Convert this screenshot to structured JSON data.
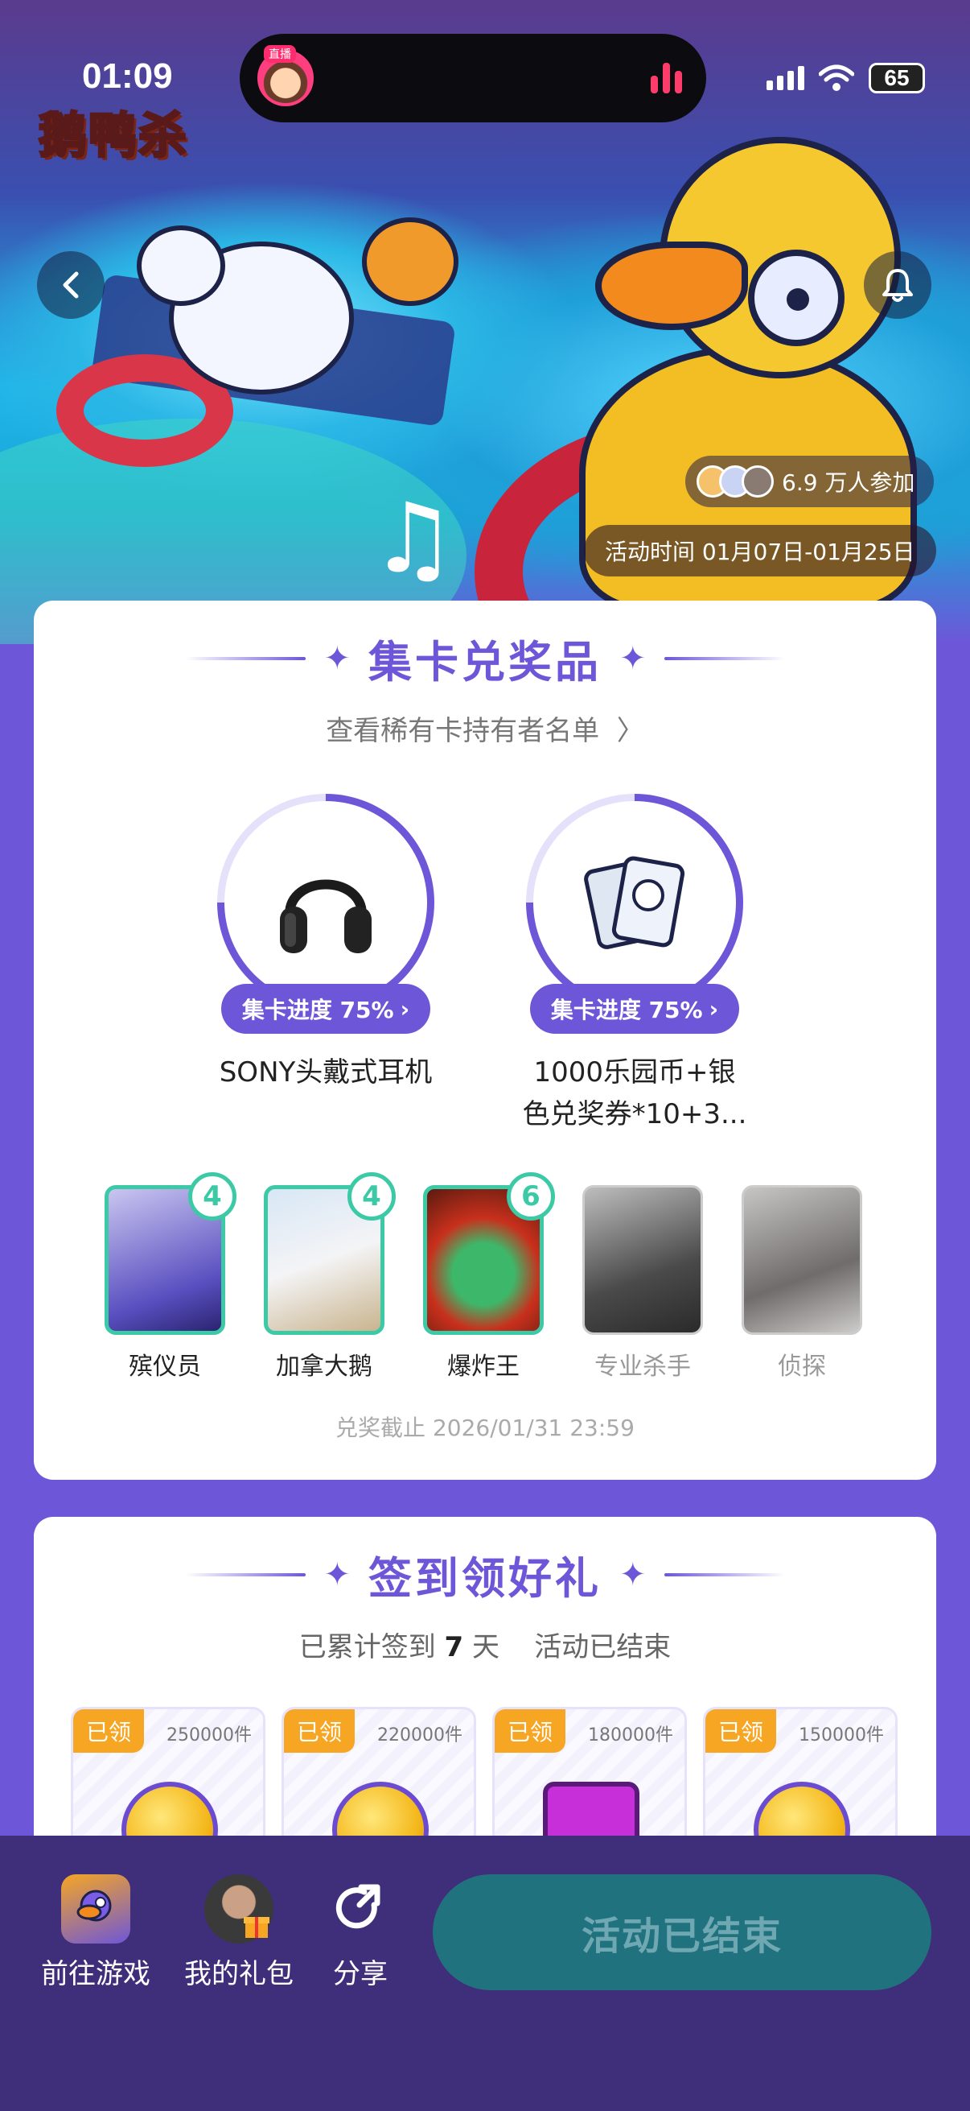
{
  "status_bar": {
    "time": "01:09",
    "live_tag": "直播",
    "battery": "65"
  },
  "hero": {
    "logo_text": "鹅鸭杀",
    "participants": "6.9 万人参加",
    "activity_time": "活动时间 01月07日-01月25日"
  },
  "card_exchange": {
    "title": "集卡兑奖品",
    "holder_link": "查看稀有卡持有者名单",
    "prizes": [
      {
        "progress_label": "集卡进度 75%",
        "progress": 0.75,
        "name": "SONY头戴式耳机"
      },
      {
        "progress_label": "集卡进度 75%",
        "progress": 0.75,
        "name_line1": "1000乐园币+银",
        "name_line2": "色兑奖券*10+3..."
      }
    ],
    "cards": [
      {
        "label": "殡仪员",
        "count": "4",
        "locked": false
      },
      {
        "label": "加拿大鹅",
        "count": "4",
        "locked": false
      },
      {
        "label": "爆炸王",
        "count": "6",
        "locked": false
      },
      {
        "label": "专业杀手",
        "locked": true
      },
      {
        "label": "侦探",
        "locked": true
      }
    ],
    "deadline": "兑奖截止 2026/01/31 23:59"
  },
  "sign_in": {
    "title": "签到领好礼",
    "summary_prefix": "已累计签到",
    "days": "7",
    "summary_suffix": "天",
    "status": "活动已结束",
    "gifts": [
      {
        "tag": "已领",
        "qty": "250000件",
        "kind": "coin"
      },
      {
        "tag": "已领",
        "qty": "220000件",
        "kind": "coin"
      },
      {
        "tag": "已领",
        "qty": "180000件",
        "kind": "box"
      },
      {
        "tag": "已领",
        "qty": "150000件",
        "kind": "coin"
      }
    ]
  },
  "bottom_bar": {
    "go_game": "前往游戏",
    "my_gifts": "我的礼包",
    "share": "分享",
    "main_button": "活动已结束"
  },
  "colors": {
    "accent": "#6e56d8",
    "teal": "#3cc9a6",
    "tag_orange": "#f6a623",
    "bottom_bg": "#3f2f7a",
    "end_button": "#21727f"
  }
}
